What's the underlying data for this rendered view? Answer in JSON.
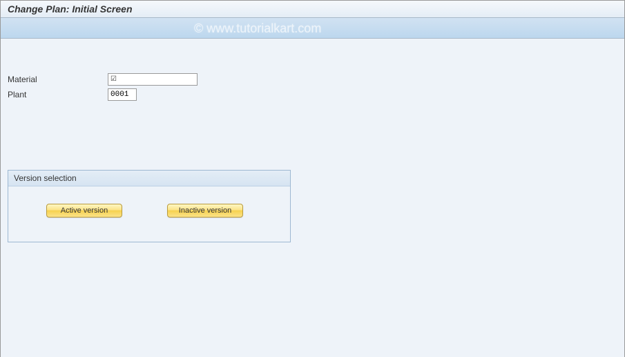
{
  "header": {
    "title": "Change Plan: Initial Screen"
  },
  "watermark": "© www.tutorialkart.com",
  "fields": {
    "material": {
      "label": "Material",
      "value": "",
      "has_check": true
    },
    "plant": {
      "label": "Plant",
      "value": "0001"
    }
  },
  "groupbox": {
    "title": "Version selection",
    "buttons": {
      "active": "Active version",
      "inactive": "Inactive version"
    }
  }
}
